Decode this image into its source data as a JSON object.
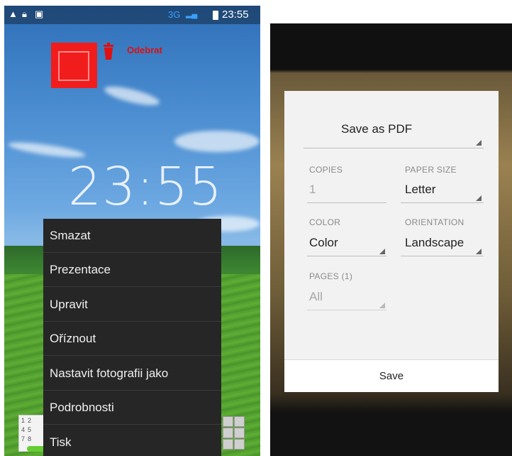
{
  "left_screen": {
    "status_bar": {
      "icons": [
        "warning-icon",
        "lock-icon",
        "image-icon"
      ],
      "network": "3G",
      "time": "23:55",
      "colors": {
        "network": "#3aa0ff",
        "bar_bg": "#00000059"
      }
    },
    "remove_label": "Odebrat",
    "lockscreen_time": "23:55",
    "context_menu": {
      "items": [
        {
          "label": "Smazat"
        },
        {
          "label": "Prezentace"
        },
        {
          "label": "Upravit"
        },
        {
          "label": "Oříznout"
        },
        {
          "label": "Nastavit fotografii jako"
        },
        {
          "label": "Podrobnosti"
        },
        {
          "label": "Tisk"
        }
      ]
    },
    "dialpad_digits": [
      "1",
      "2",
      "4",
      "5",
      "7",
      "8"
    ],
    "accent_colors": {
      "remove": "#e01010",
      "menu_bg": "#262626"
    }
  },
  "right_screen": {
    "print_dialog": {
      "printer": "Save as PDF",
      "copies": {
        "label": "COPIES",
        "value": "1"
      },
      "paper_size": {
        "label": "PAPER SIZE",
        "value": "Letter"
      },
      "color": {
        "label": "COLOR",
        "value": "Color"
      },
      "orientation": {
        "label": "ORIENTATION",
        "value": "Landscape"
      },
      "pages": {
        "label": "PAGES (1)",
        "value": "All"
      },
      "save_button": "Save"
    }
  }
}
